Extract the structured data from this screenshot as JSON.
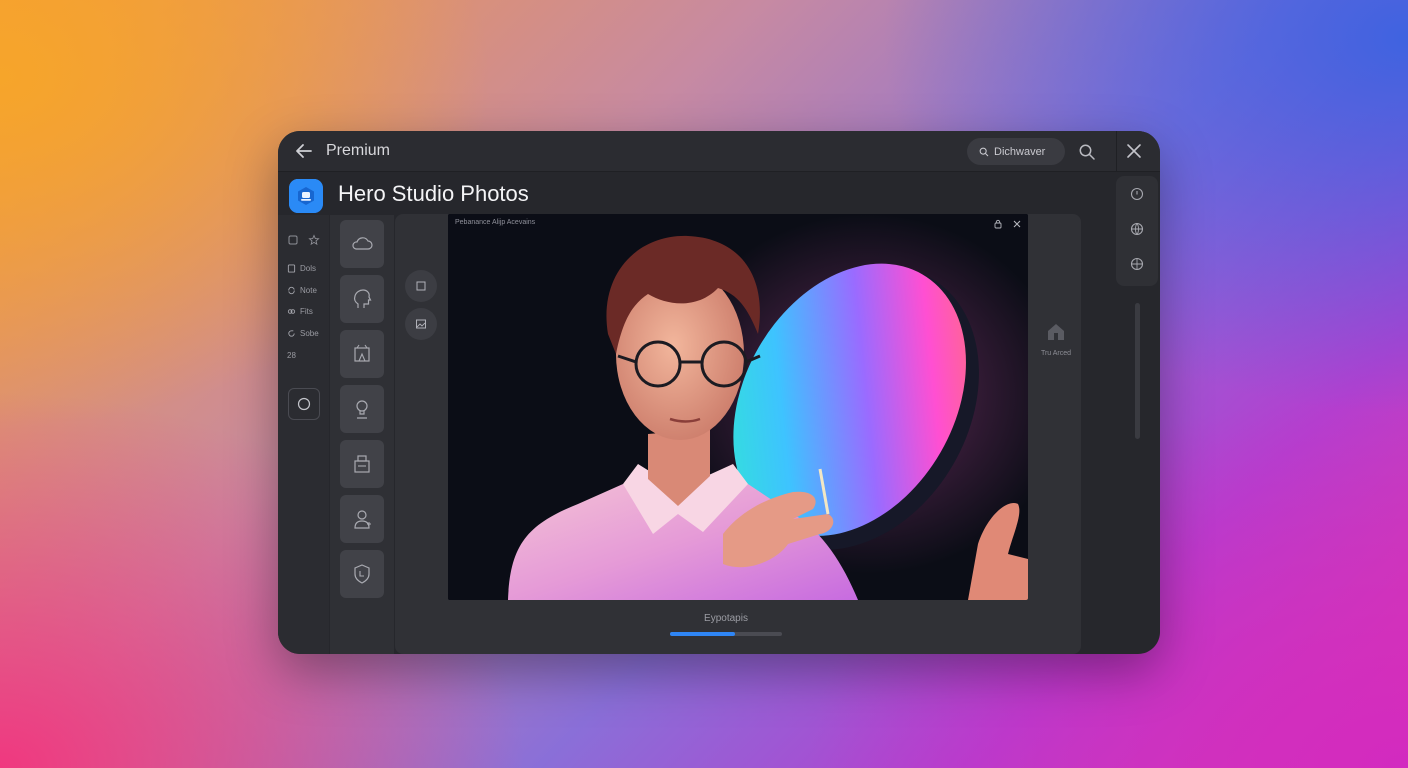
{
  "window": {
    "title": "Premium",
    "pill_label": "Dichwaver",
    "app_title": "Hero Studio Photos"
  },
  "left_sidebar": {
    "items": [
      {
        "label": "Dols",
        "icon": "page-icon"
      },
      {
        "label": "Note",
        "icon": "sync-icon"
      },
      {
        "label": "Fits",
        "icon": "link-icon"
      },
      {
        "label": "Sobe",
        "icon": "refresh-icon"
      },
      {
        "label": "28",
        "icon": ""
      }
    ]
  },
  "tools": [
    {
      "name": "cloud-tool",
      "icon": "cloud-icon"
    },
    {
      "name": "head-tool",
      "icon": "head-profile-icon"
    },
    {
      "name": "frame-tool",
      "icon": "frame-icon"
    },
    {
      "name": "person-tool",
      "icon": "person-icon"
    },
    {
      "name": "printer-tool",
      "icon": "printer-icon"
    },
    {
      "name": "user-add-tool",
      "icon": "user-icon"
    },
    {
      "name": "shield-tool",
      "icon": "shield-icon"
    }
  ],
  "canvas": {
    "caption": "Pebanance Alijp Acevains"
  },
  "right_panel": {
    "label": "Tru Arced"
  },
  "progress": {
    "label": "Eypotapis",
    "value": 0.58
  },
  "colors": {
    "accent": "#2f86f5",
    "window_bg": "#26272c"
  }
}
